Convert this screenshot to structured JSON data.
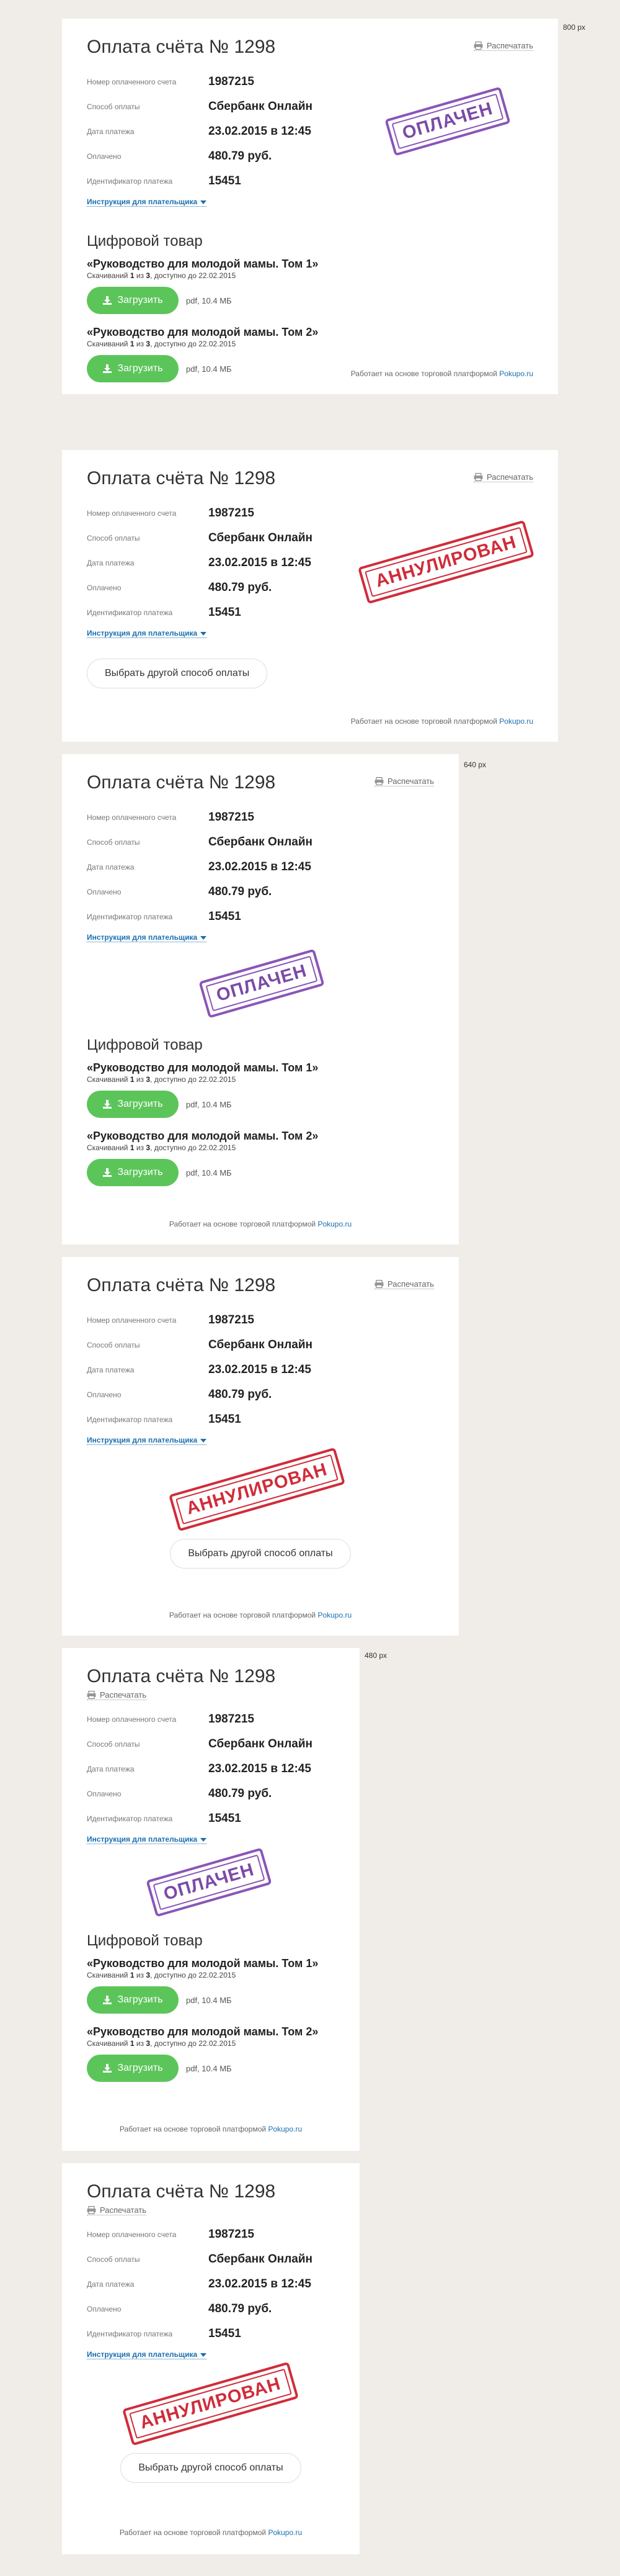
{
  "width_labels": [
    "800 px",
    "640 px",
    "480 px"
  ],
  "invoice": {
    "title": "Оплата счёта № 1298",
    "print_label": "Распечатать",
    "fields": [
      {
        "label": "Номер оплаченного счета",
        "value": "1987215"
      },
      {
        "label": "Способ оплаты",
        "value": "Сбербанк Онлайн"
      },
      {
        "label": "Дата платежа",
        "value": "23.02.2015 в 12:45"
      },
      {
        "label": "Оплачено",
        "value": "480.79 руб."
      },
      {
        "label": "Идентификатор платежа",
        "value": "15451"
      }
    ],
    "instructions_label": "Инструкция для плательщика"
  },
  "stamps": {
    "paid": "ОПЛАЧЕН",
    "annulled": "АННУЛИРОВАН"
  },
  "goods": {
    "title": "Цифровой товар",
    "items": [
      {
        "name": "«Руководство для молодой мамы. Том 1»",
        "downloads_prefix": "Скачиваний ",
        "downloads_used": "1",
        "downloads_of": " из ",
        "downloads_total": "3",
        "available": ", доступно до 22.02.2015",
        "button": "Загрузить",
        "file": "pdf, 10.4 МБ"
      },
      {
        "name": "«Руководство для молодой мамы. Том 2»",
        "downloads_prefix": "Скачиваний ",
        "downloads_used": "1",
        "downloads_of": " из ",
        "downloads_total": "3",
        "available": ", доступно до 22.02.2015",
        "button": "Загрузить",
        "file": "pdf, 10.4 МБ"
      }
    ]
  },
  "other_method_button": "Выбрать другой способ оплаты",
  "footer": {
    "text": "Работает на основе торговой платформой ",
    "link": "Pokupo.ru"
  }
}
